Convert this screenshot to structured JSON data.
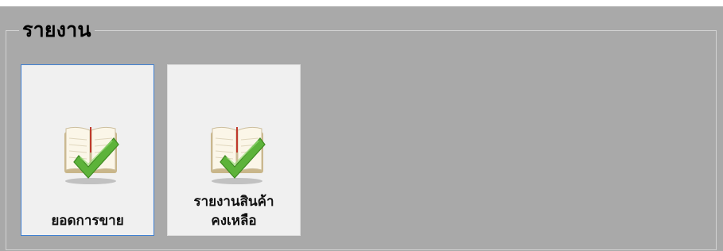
{
  "group": {
    "title": "รายงาน"
  },
  "tiles": [
    {
      "label": "ยอดการขาย",
      "icon": "report-book-check-icon",
      "selected": true
    },
    {
      "label": "รายงานสินค้า\nคงเหลือ",
      "icon": "report-book-check-icon",
      "selected": false
    }
  ],
  "colors": {
    "panel_background": "#a9a9a9",
    "tile_background": "#f0f0f0",
    "selected_border": "#3e7fd1",
    "check_green": "#5db33a"
  }
}
